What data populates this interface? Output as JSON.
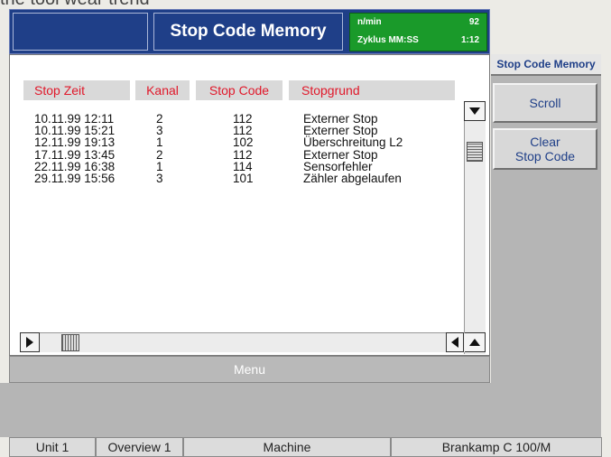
{
  "background_text": "the tool wear trend",
  "header": {
    "title": "Stop Code Memory",
    "status": {
      "speed_label": "n/min",
      "speed_value": "92",
      "cycle_label": "Zyklus MM:SS",
      "cycle_value": "1:12"
    }
  },
  "table": {
    "columns": [
      "Stop Zeit",
      "Kanal",
      "Stop Code",
      "Stopgrund"
    ],
    "rows": [
      [
        "10.11.99 12:11",
        "2",
        "112",
        "Externer Stop"
      ],
      [
        "10.11.99 15:21",
        "3",
        "112",
        "Externer Stop"
      ],
      [
        "12.11.99 19:13",
        "1",
        "102",
        "Überschreitung L2"
      ],
      [
        "17.11.99 13:45",
        "2",
        "112",
        "Externer Stop"
      ],
      [
        "22.11.99 16:38",
        "1",
        "114",
        "Sensorfehler"
      ],
      [
        "29.11.99 15:56",
        "3",
        "101",
        "Zähler abgelaufen"
      ]
    ]
  },
  "menu": {
    "label": "Menu"
  },
  "side": {
    "title": "Stop Code Memory",
    "buttons": [
      "Scroll",
      "Clear",
      "Stop Code"
    ]
  },
  "tabs": [
    "Unit 1",
    "Overview 1",
    "Machine",
    "Brankamp C 100/M"
  ],
  "colors": {
    "header_bg": "#1f3f88",
    "status_bg": "#1a9a2a",
    "column_header_text": "#e0182a"
  }
}
